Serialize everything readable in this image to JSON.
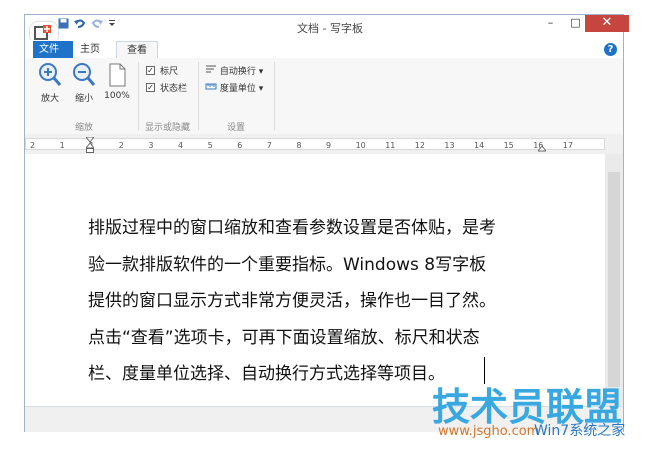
{
  "window": {
    "title": "文档 - 写字板",
    "minimize": "–",
    "maximize": "□",
    "close": "✕"
  },
  "qat": {
    "save_icon": "save-icon",
    "undo_icon": "undo-icon",
    "redo_icon": "redo-icon",
    "customize_icon": "customize-icon"
  },
  "tabs": {
    "file": "文件",
    "home": "主页",
    "view": "查看",
    "help": "?"
  },
  "ribbon": {
    "zoom": {
      "zoom_in": "放大",
      "zoom_out": "缩小",
      "hundred": "100%",
      "group_label": "缩放"
    },
    "show_hide": {
      "ruler": "标尺",
      "statusbar": "状态栏",
      "ruler_checked": true,
      "statusbar_checked": true,
      "group_label": "显示或隐藏"
    },
    "settings": {
      "word_wrap": "自动换行",
      "measurement_units": "度量单位",
      "group_label": "设置"
    }
  },
  "ruler": {
    "ticks": [
      "2",
      "1",
      "1",
      "2",
      "3",
      "4",
      "5",
      "6",
      "7",
      "8",
      "9",
      "10",
      "11",
      "12",
      "13",
      "14",
      "15",
      "16",
      "17"
    ]
  },
  "document": {
    "lines": [
      "排版过程中的窗口缩放和查看参数设置是否体贴，是考",
      "验一款排版软件的一个重要指标。Windows 8写字板",
      "提供的窗口显示方式非常方便灵活，操作也一目了然。",
      "点击“查看”选项卡，可再下面设置缩放、标尺和状态",
      "栏、度量单位选择、自动换行方式选择等项目。"
    ]
  },
  "watermark": {
    "brand": "技术员联盟",
    "url": "www.jsgho.com",
    "sub": "Win7系统之家"
  },
  "colors": {
    "file_tab": "#1e73c9",
    "close_button": "#c7453f",
    "watermark_blue": "#3aa8e0",
    "watermark_orange": "#d4762a"
  }
}
